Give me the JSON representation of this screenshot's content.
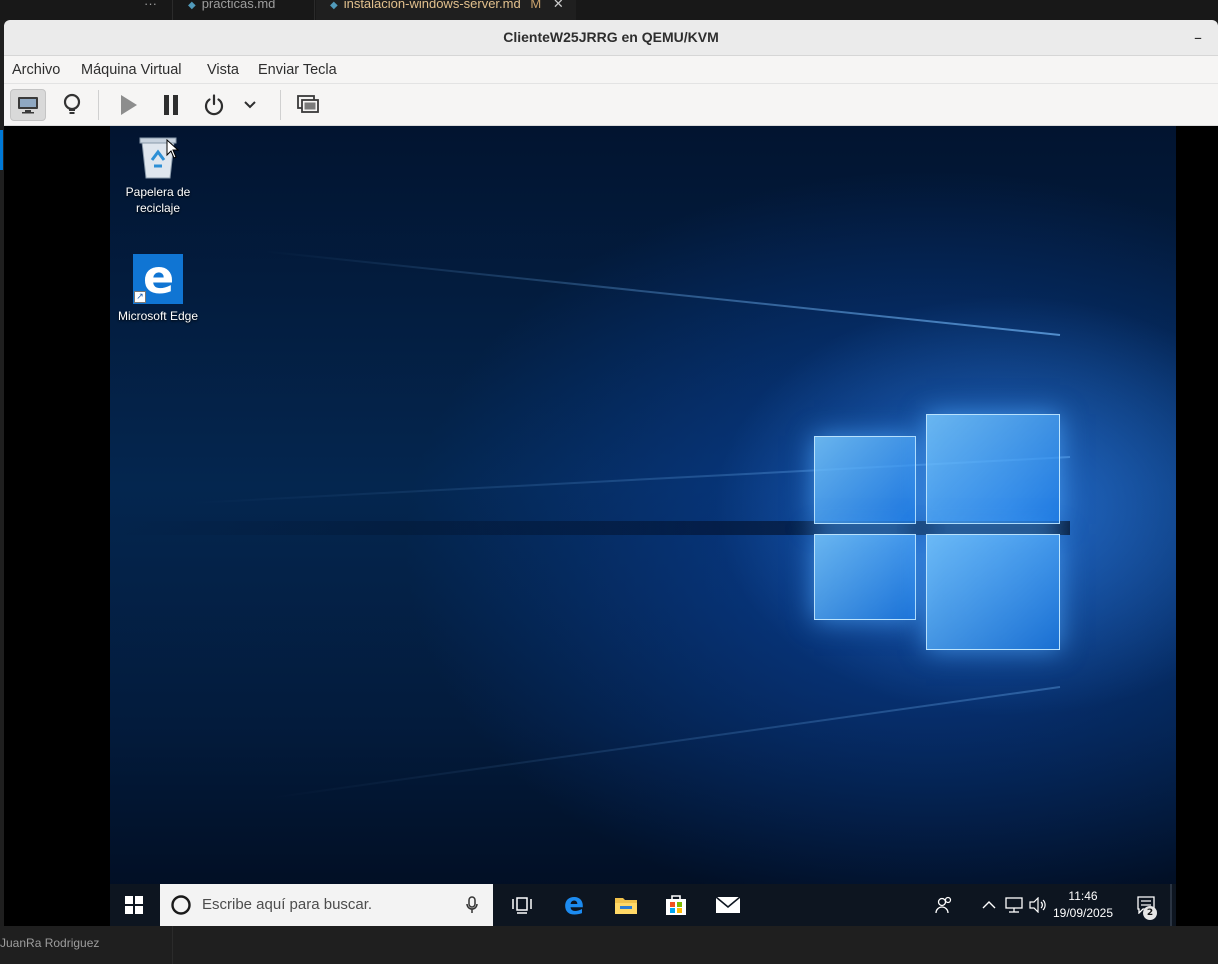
{
  "editor": {
    "tabs": [
      {
        "label": "practicas.md"
      },
      {
        "label": "instalacion-windows-server.md",
        "status": "M"
      }
    ],
    "overflow_label": "···",
    "author": "JuanRa Rodriguez"
  },
  "window": {
    "title": "ClienteW25JRRG en QEMU/KVM",
    "minimize_label": "–"
  },
  "menu": {
    "items": [
      "Archivo",
      "Máquina Virtual",
      "Vista",
      "Enviar Tecla"
    ]
  },
  "toolbar": {
    "buttons": [
      "console-view",
      "details-view",
      "run",
      "pause",
      "shutdown",
      "shutdown-menu",
      "fullscreen"
    ]
  },
  "guest": {
    "desktop_icons": [
      {
        "label": "Papelera de reciclaje",
        "icon": "recycle-bin-icon"
      },
      {
        "label": "Microsoft Edge",
        "icon": "edge-icon"
      }
    ],
    "taskbar": {
      "search_placeholder": "Escribe aquí para buscar.",
      "time": "11:46",
      "date": "19/09/2025",
      "notifications_count": "2"
    }
  },
  "colors": {
    "taskbar_bg": "#0d1520",
    "window_titlebar": "#ebebeb",
    "accent": "#0078d4"
  }
}
